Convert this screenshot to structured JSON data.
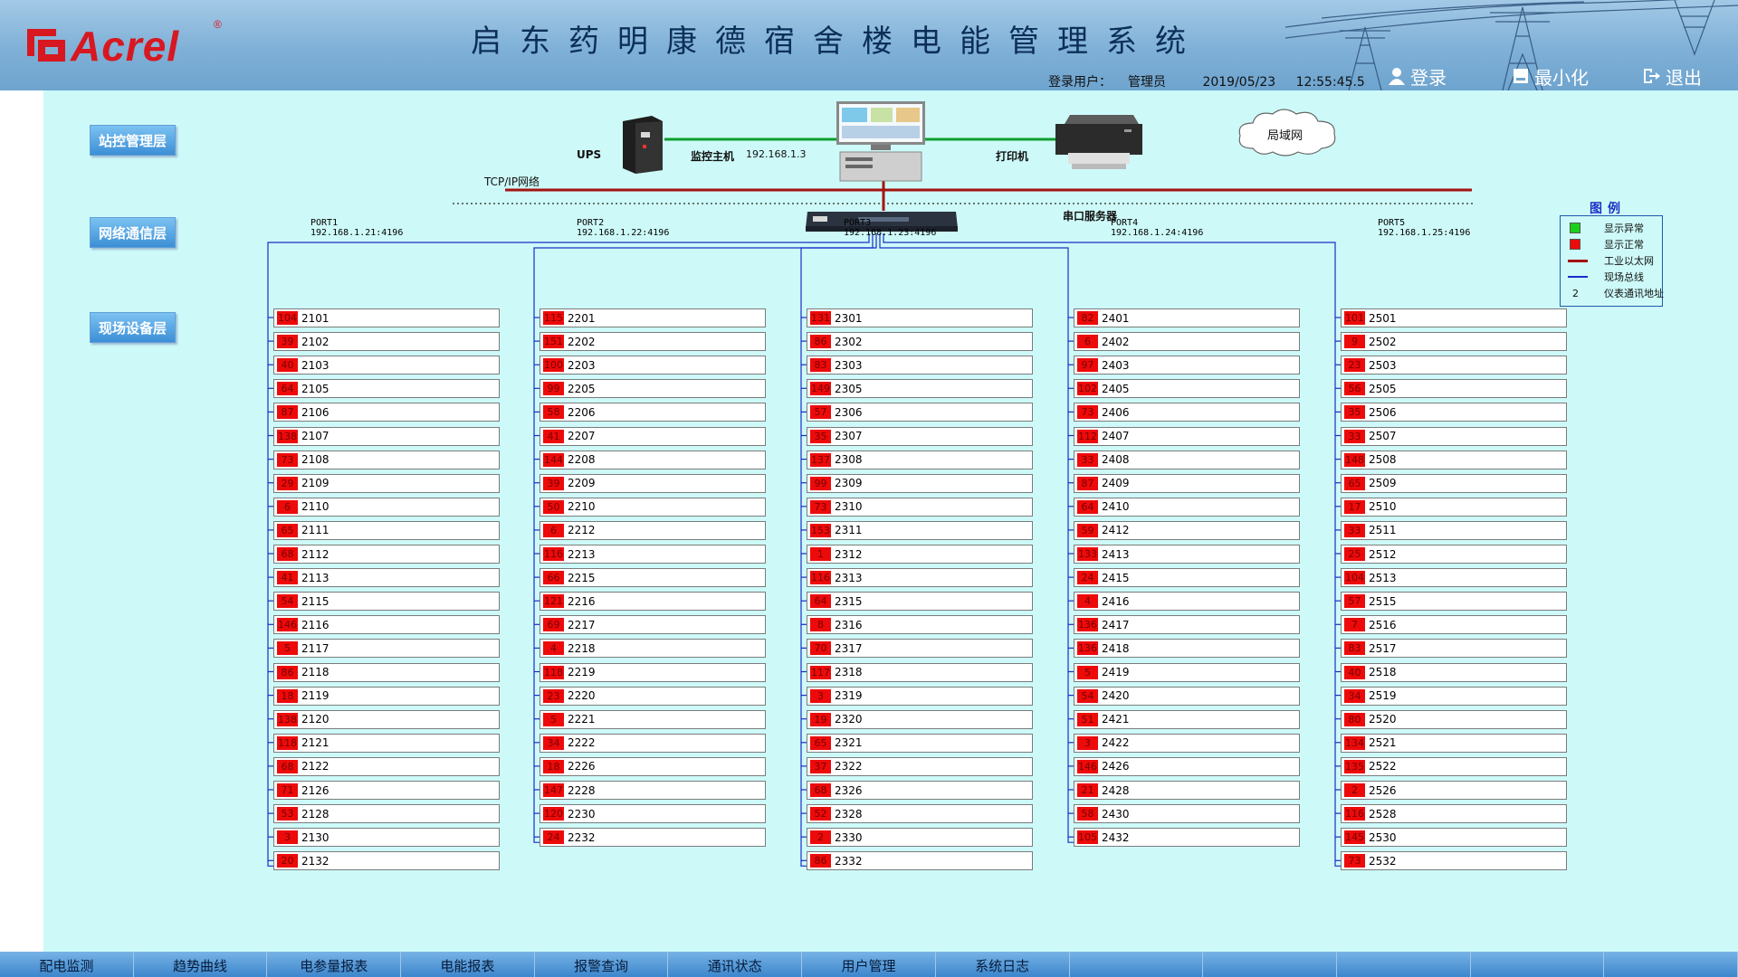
{
  "header": {
    "logo_text": "Acrel",
    "logo_reg": "®",
    "title": "启东药明康德宿舍楼电能管理系统",
    "login_label": "登录用户：",
    "user": "管理员",
    "date": "2019/05/23",
    "time": "12:55:45.5",
    "buttons": {
      "login": "登录",
      "minimize": "最小化",
      "exit": "退出"
    }
  },
  "layers": {
    "station": "站控管理层",
    "network": "网络通信层",
    "field": "现场设备层"
  },
  "topology": {
    "ups": "UPS",
    "host": "监控主机",
    "host_ip": "192.168.1.3",
    "printer": "打印机",
    "lan": "局域网",
    "tcpip": "TCP/IP网络",
    "serial_server": "串口服务器"
  },
  "legend": {
    "title": "图例",
    "items": [
      "显示异常",
      "显示正常",
      "工业以太网",
      "现场总线",
      "仪表通讯地址"
    ],
    "addr_sample": "2"
  },
  "colors": {
    "abnormal": "#19d119",
    "normal": "#ee0b0b",
    "ethernet": "#a51212",
    "fieldbus": "#1b2cc8"
  },
  "ports": [
    {
      "name": "PORT1",
      "ip": "192.168.1.21:4196",
      "devices": [
        [
          "104",
          "2101"
        ],
        [
          "39",
          "2102"
        ],
        [
          "40",
          "2103"
        ],
        [
          "64",
          "2105"
        ],
        [
          "87",
          "2106"
        ],
        [
          "138",
          "2107"
        ],
        [
          "73",
          "2108"
        ],
        [
          "29",
          "2109"
        ],
        [
          "6",
          "2110"
        ],
        [
          "65",
          "2111"
        ],
        [
          "68",
          "2112"
        ],
        [
          "41",
          "2113"
        ],
        [
          "54",
          "2115"
        ],
        [
          "146",
          "2116"
        ],
        [
          "5",
          "2117"
        ],
        [
          "86",
          "2118"
        ],
        [
          "18",
          "2119"
        ],
        [
          "138",
          "2120"
        ],
        [
          "118",
          "2121"
        ],
        [
          "68",
          "2122"
        ],
        [
          "71",
          "2126"
        ],
        [
          "53",
          "2128"
        ],
        [
          "3",
          "2130"
        ],
        [
          "20",
          "2132"
        ]
      ]
    },
    {
      "name": "PORT2",
      "ip": "192.168.1.22:4196",
      "devices": [
        [
          "115",
          "2201"
        ],
        [
          "151",
          "2202"
        ],
        [
          "100",
          "2203"
        ],
        [
          "99",
          "2205"
        ],
        [
          "58",
          "2206"
        ],
        [
          "41",
          "2207"
        ],
        [
          "144",
          "2208"
        ],
        [
          "39",
          "2209"
        ],
        [
          "50",
          "2210"
        ],
        [
          "6",
          "2212"
        ],
        [
          "116",
          "2213"
        ],
        [
          "66",
          "2215"
        ],
        [
          "121",
          "2216"
        ],
        [
          "69",
          "2217"
        ],
        [
          "4",
          "2218"
        ],
        [
          "118",
          "2219"
        ],
        [
          "23",
          "2220"
        ],
        [
          "5",
          "2221"
        ],
        [
          "34",
          "2222"
        ],
        [
          "18",
          "2226"
        ],
        [
          "147",
          "2228"
        ],
        [
          "120",
          "2230"
        ],
        [
          "24",
          "2232"
        ]
      ]
    },
    {
      "name": "PORT3",
      "ip": "192.168.1.23:4196",
      "devices": [
        [
          "131",
          "2301"
        ],
        [
          "86",
          "2302"
        ],
        [
          "83",
          "2303"
        ],
        [
          "149",
          "2305"
        ],
        [
          "57",
          "2306"
        ],
        [
          "35",
          "2307"
        ],
        [
          "137",
          "2308"
        ],
        [
          "99",
          "2309"
        ],
        [
          "73",
          "2310"
        ],
        [
          "153",
          "2311"
        ],
        [
          "1",
          "2312"
        ],
        [
          "116",
          "2313"
        ],
        [
          "64",
          "2315"
        ],
        [
          "8",
          "2316"
        ],
        [
          "70",
          "2317"
        ],
        [
          "117",
          "2318"
        ],
        [
          "3",
          "2319"
        ],
        [
          "19",
          "2320"
        ],
        [
          "65",
          "2321"
        ],
        [
          "37",
          "2322"
        ],
        [
          "68",
          "2326"
        ],
        [
          "52",
          "2328"
        ],
        [
          "2",
          "2330"
        ],
        [
          "86",
          "2332"
        ]
      ]
    },
    {
      "name": "PORT4",
      "ip": "192.168.1.24:4196",
      "devices": [
        [
          "82",
          "2401"
        ],
        [
          "6",
          "2402"
        ],
        [
          "97",
          "2403"
        ],
        [
          "102",
          "2405"
        ],
        [
          "73",
          "2406"
        ],
        [
          "112",
          "2407"
        ],
        [
          "33",
          "2408"
        ],
        [
          "87",
          "2409"
        ],
        [
          "64",
          "2410"
        ],
        [
          "59",
          "2412"
        ],
        [
          "133",
          "2413"
        ],
        [
          "24",
          "2415"
        ],
        [
          "4",
          "2416"
        ],
        [
          "136",
          "2417"
        ],
        [
          "136",
          "2418"
        ],
        [
          "5",
          "2419"
        ],
        [
          "54",
          "2420"
        ],
        [
          "51",
          "2421"
        ],
        [
          "3",
          "2422"
        ],
        [
          "146",
          "2426"
        ],
        [
          "21",
          "2428"
        ],
        [
          "58",
          "2430"
        ],
        [
          "105",
          "2432"
        ]
      ]
    },
    {
      "name": "PORT5",
      "ip": "192.168.1.25:4196",
      "devices": [
        [
          "101",
          "2501"
        ],
        [
          "9",
          "2502"
        ],
        [
          "23",
          "2503"
        ],
        [
          "56",
          "2505"
        ],
        [
          "35",
          "2506"
        ],
        [
          "33",
          "2507"
        ],
        [
          "148",
          "2508"
        ],
        [
          "65",
          "2509"
        ],
        [
          "17",
          "2510"
        ],
        [
          "33",
          "2511"
        ],
        [
          "25",
          "2512"
        ],
        [
          "104",
          "2513"
        ],
        [
          "57",
          "2515"
        ],
        [
          "7",
          "2516"
        ],
        [
          "83",
          "2517"
        ],
        [
          "40",
          "2518"
        ],
        [
          "34",
          "2519"
        ],
        [
          "80",
          "2520"
        ],
        [
          "134",
          "2521"
        ],
        [
          "135",
          "2522"
        ],
        [
          "2",
          "2526"
        ],
        [
          "116",
          "2528"
        ],
        [
          "145",
          "2530"
        ],
        [
          "73",
          "2532"
        ]
      ]
    }
  ],
  "tabs": [
    "配电监测",
    "趋势曲线",
    "电参量报表",
    "电能报表",
    "报警查询",
    "通讯状态",
    "用户管理",
    "系统日志",
    "",
    "",
    "",
    "",
    ""
  ]
}
